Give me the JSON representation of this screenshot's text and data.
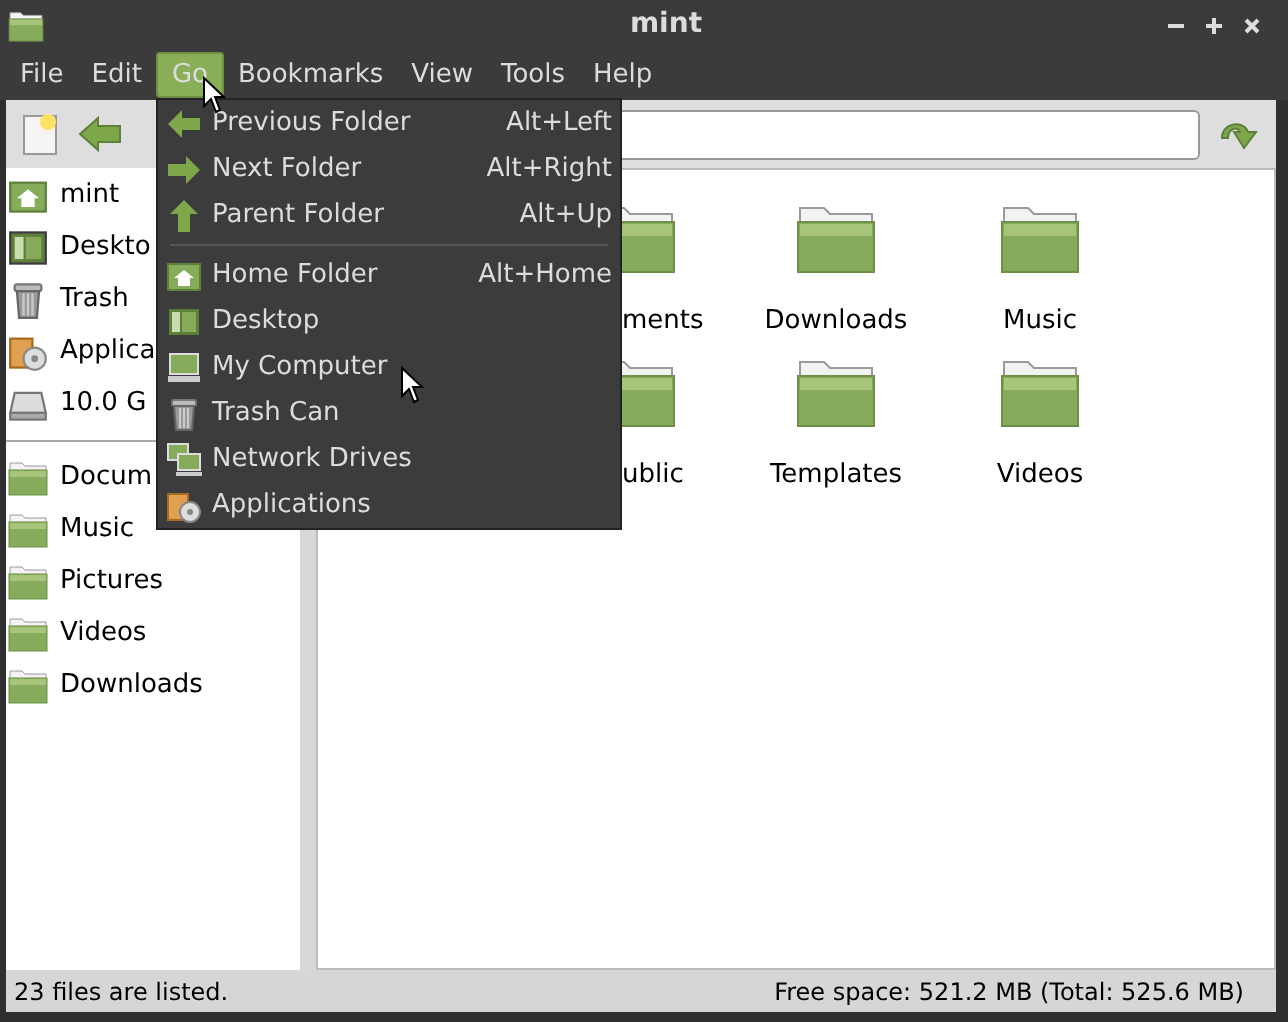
{
  "window": {
    "title": "mint"
  },
  "menu_bar": [
    {
      "label": "File",
      "selected": false
    },
    {
      "label": "Edit",
      "selected": false
    },
    {
      "label": "Go",
      "selected": true
    },
    {
      "label": "Bookmarks",
      "selected": false
    },
    {
      "label": "View",
      "selected": false
    },
    {
      "label": "Tools",
      "selected": false
    },
    {
      "label": "Help",
      "selected": false
    }
  ],
  "go_menu": [
    {
      "kind": "back",
      "label": "Previous Folder",
      "shortcut": "Alt+Left"
    },
    {
      "kind": "forward",
      "label": "Next Folder",
      "shortcut": "Alt+Right"
    },
    {
      "kind": "up",
      "label": "Parent Folder",
      "shortcut": "Alt+Up"
    },
    {
      "kind": "separator"
    },
    {
      "kind": "home",
      "label": "Home Folder",
      "shortcut": "Alt+Home"
    },
    {
      "kind": "desktop",
      "label": "Desktop"
    },
    {
      "kind": "computer",
      "label": "My Computer"
    },
    {
      "kind": "trash",
      "label": "Trash Can"
    },
    {
      "kind": "network",
      "label": "Network Drives"
    },
    {
      "kind": "apps",
      "label": "Applications"
    }
  ],
  "sidebar": {
    "places": [
      {
        "kind": "home",
        "label": "mint"
      },
      {
        "kind": "desktop",
        "label": "Deskto"
      },
      {
        "kind": "trash",
        "label": "Trash"
      },
      {
        "kind": "apps",
        "label": "Applica"
      },
      {
        "kind": "drive",
        "label": "10.0 G"
      }
    ],
    "bookmarks": [
      {
        "kind": "folder",
        "label": "Docum"
      },
      {
        "kind": "folder",
        "label": "Music"
      },
      {
        "kind": "folder",
        "label": "Pictures"
      },
      {
        "kind": "folder",
        "label": "Videos"
      },
      {
        "kind": "folder",
        "label": "Downloads"
      }
    ]
  },
  "folders": [
    [
      {
        "kind": "clipped",
        "label": "ments"
      },
      {
        "kind": "folder",
        "label": "Downloads"
      },
      {
        "kind": "folder",
        "label": "Music"
      }
    ],
    [
      {
        "kind": "clipped",
        "label": "ublic"
      },
      {
        "kind": "folder",
        "label": "Templates"
      },
      {
        "kind": "folder",
        "label": "Videos"
      }
    ]
  ],
  "status_bar": {
    "left": "23 files are listed.",
    "right": "Free space: 521.2 MB (Total: 525.6 MB)"
  }
}
